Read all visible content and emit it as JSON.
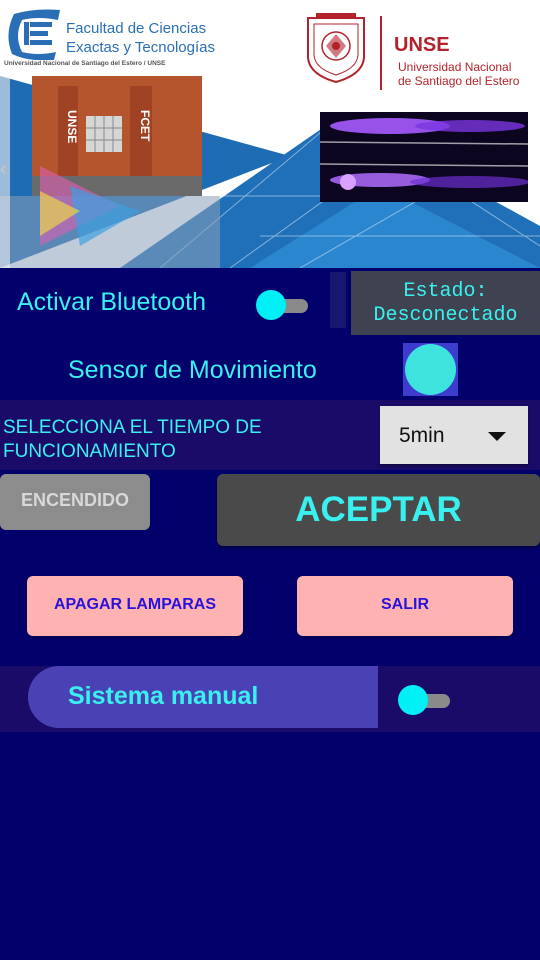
{
  "header": {
    "faculty_line1": "Facultad de Ciencias",
    "faculty_line2": "Exactas y Tecnologías",
    "faculty_sub": "Universidad Nacional de Santiago del Estero / UNSE",
    "building_text_left": "UNSE",
    "building_text_right": "FCET",
    "unse_title": "UNSE",
    "unse_sub1": "Universidad Nacional",
    "unse_sub2": "de Santiago del Estero",
    "colors": {
      "brand_blue": "#1f6fb8",
      "unse_red": "#b3232b"
    }
  },
  "bluetooth": {
    "label": "Activar Bluetooth",
    "enabled": false,
    "status_line1": "Estado:",
    "status_line2": "Desconectado"
  },
  "sensor": {
    "label": "Sensor de Movimiento"
  },
  "timer": {
    "label_line1": "SELECCIONA EL TIEMPO DE",
    "label_line2": "FUNCIONAMIENTO",
    "selected": "5min"
  },
  "buttons": {
    "encendido": "ENCENDIDO",
    "aceptar": "ACEPTAR",
    "apagar": "APAGAR LAMPARAS",
    "salir": "SALIR"
  },
  "manual": {
    "label": "Sistema manual",
    "enabled": false
  },
  "icons": {
    "nav_left": "chevron-left-icon",
    "dropdown": "caret-down-icon"
  },
  "theme": {
    "background": "#02006b",
    "accent": "#39f0ef",
    "switch_thumb": "#00f0f5",
    "button_pink": "#ffb2b2",
    "button_text_blue": "#2a13d8"
  }
}
